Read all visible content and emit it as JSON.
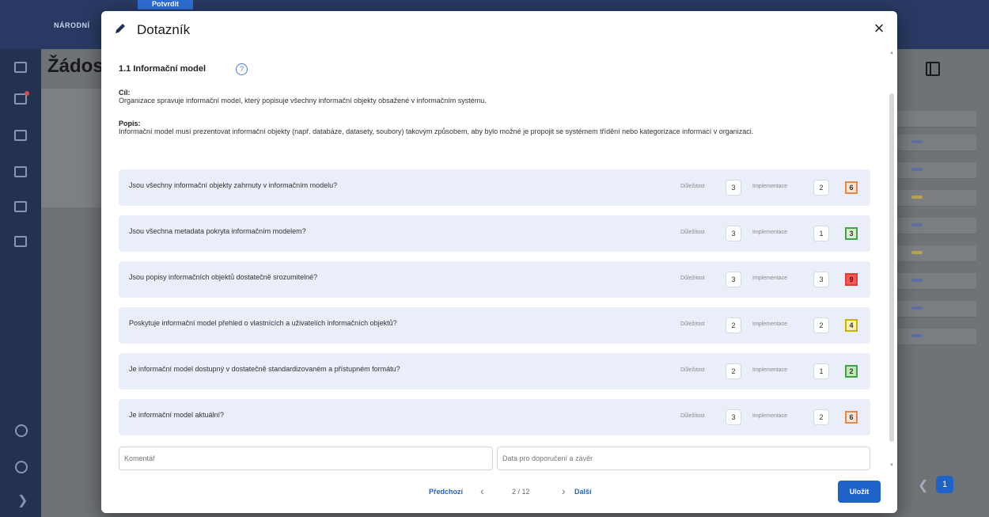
{
  "background": {
    "nav_label": "NÁRODNÍ",
    "confirm_label": "Potvrdit",
    "page_title": "Žádos",
    "pager_current": "1"
  },
  "modal": {
    "title": "Dotazník",
    "close_symbol": "×",
    "section_title": "1.1 Informační model",
    "goal_label": "Cíl:",
    "goal_text": "Organizace spravuje informační model, který popisuje všechny informační objekty obsažené v informačním systému.",
    "desc_label": "Popis:",
    "desc_text": "Informační model musí prezentovat informační objekty (např. databáze, datasety, soubory) takovým způsobem, aby bylo možné je propojit se systémem třídění nebo kategorizace informací v organizaci.",
    "importance_label": "Důležitost",
    "implementation_label": "Implementace",
    "questions": [
      {
        "text": "Jsou všechny informační objekty zahrnuty v informačním modelu?",
        "importance": "3",
        "implementation": "2",
        "score": "6",
        "score_color": "#e8874a",
        "score_bg": "#fde2cf"
      },
      {
        "text": "Jsou všechna metadata pokryta informačním modelem?",
        "importance": "3",
        "implementation": "1",
        "score": "3",
        "score_color": "#3fa447",
        "score_bg": "#d8f0d0"
      },
      {
        "text": "Jsou popisy informačních objektů dostatečně srozumitelné?",
        "importance": "3",
        "implementation": "3",
        "score": "9",
        "score_color": "#e03a3a",
        "score_bg": "#f15a5a"
      },
      {
        "text": "Poskytuje informační model přehled o vlastnících a uživatelích informačních objektů?",
        "importance": "2",
        "implementation": "2",
        "score": "4",
        "score_color": "#c8b400",
        "score_bg": "#faf3b0"
      },
      {
        "text": "Je informační model dostupný v dostatečně standardizovaném a přístupném formátu?",
        "importance": "2",
        "implementation": "1",
        "score": "2",
        "score_color": "#3fa447",
        "score_bg": "#bfe8b2"
      },
      {
        "text": "Je informační model aktuální?",
        "importance": "3",
        "implementation": "2",
        "score": "6",
        "score_color": "#e8874a",
        "score_bg": "#fde2cf"
      }
    ],
    "comment_placeholder": "Komentář",
    "recommendation_placeholder": "Data pro doporučení a závěr",
    "prev_label": "Předchozí",
    "page_indicator": "2 / 12",
    "next_label": "Další",
    "save_label": "Uložit"
  }
}
